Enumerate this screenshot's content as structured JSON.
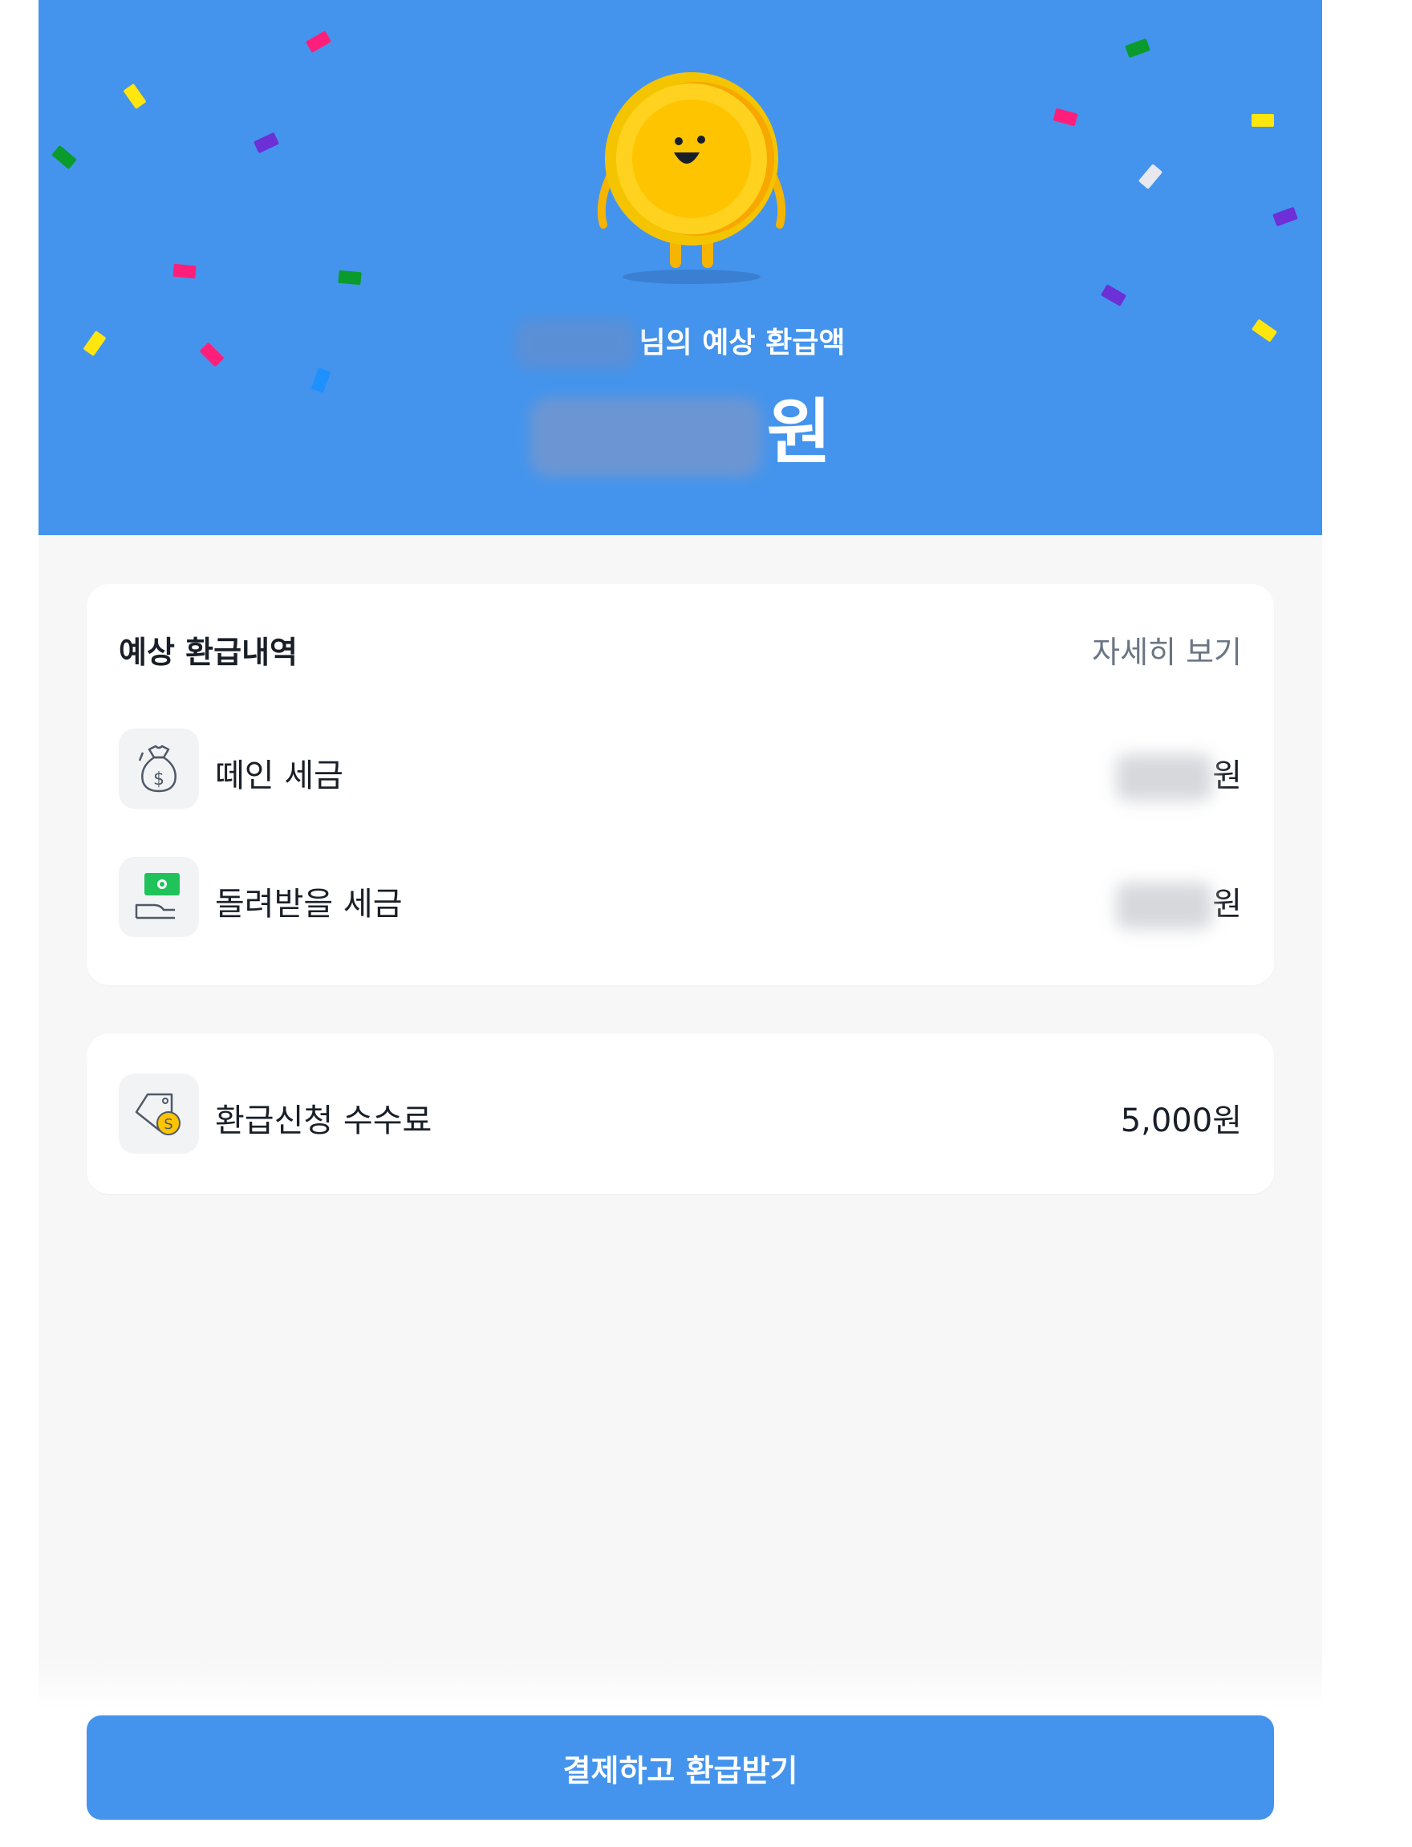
{
  "colors": {
    "primary": "#4494ed",
    "background": "#f7f7f8",
    "text": "#191f28",
    "muted": "#6b7684"
  },
  "hero": {
    "user_name": "",
    "subtitle_suffix": "님의 예상 환급액",
    "amount": "",
    "amount_unit": "원",
    "mascot": "coin-character"
  },
  "breakdown": {
    "title": "예상 환급내역",
    "detail_link": "자세히 보기",
    "items": [
      {
        "icon": "money-bag-icon",
        "label": "떼인 세금",
        "value": "",
        "unit": "원"
      },
      {
        "icon": "cash-hand-icon",
        "label": "돌려받을 세금",
        "value": "",
        "unit": "원"
      }
    ]
  },
  "fee": {
    "icon": "price-tag-coin-icon",
    "label": "환급신청 수수료",
    "value": "5,000원"
  },
  "cta": {
    "label": "결제하고 환급받기"
  }
}
